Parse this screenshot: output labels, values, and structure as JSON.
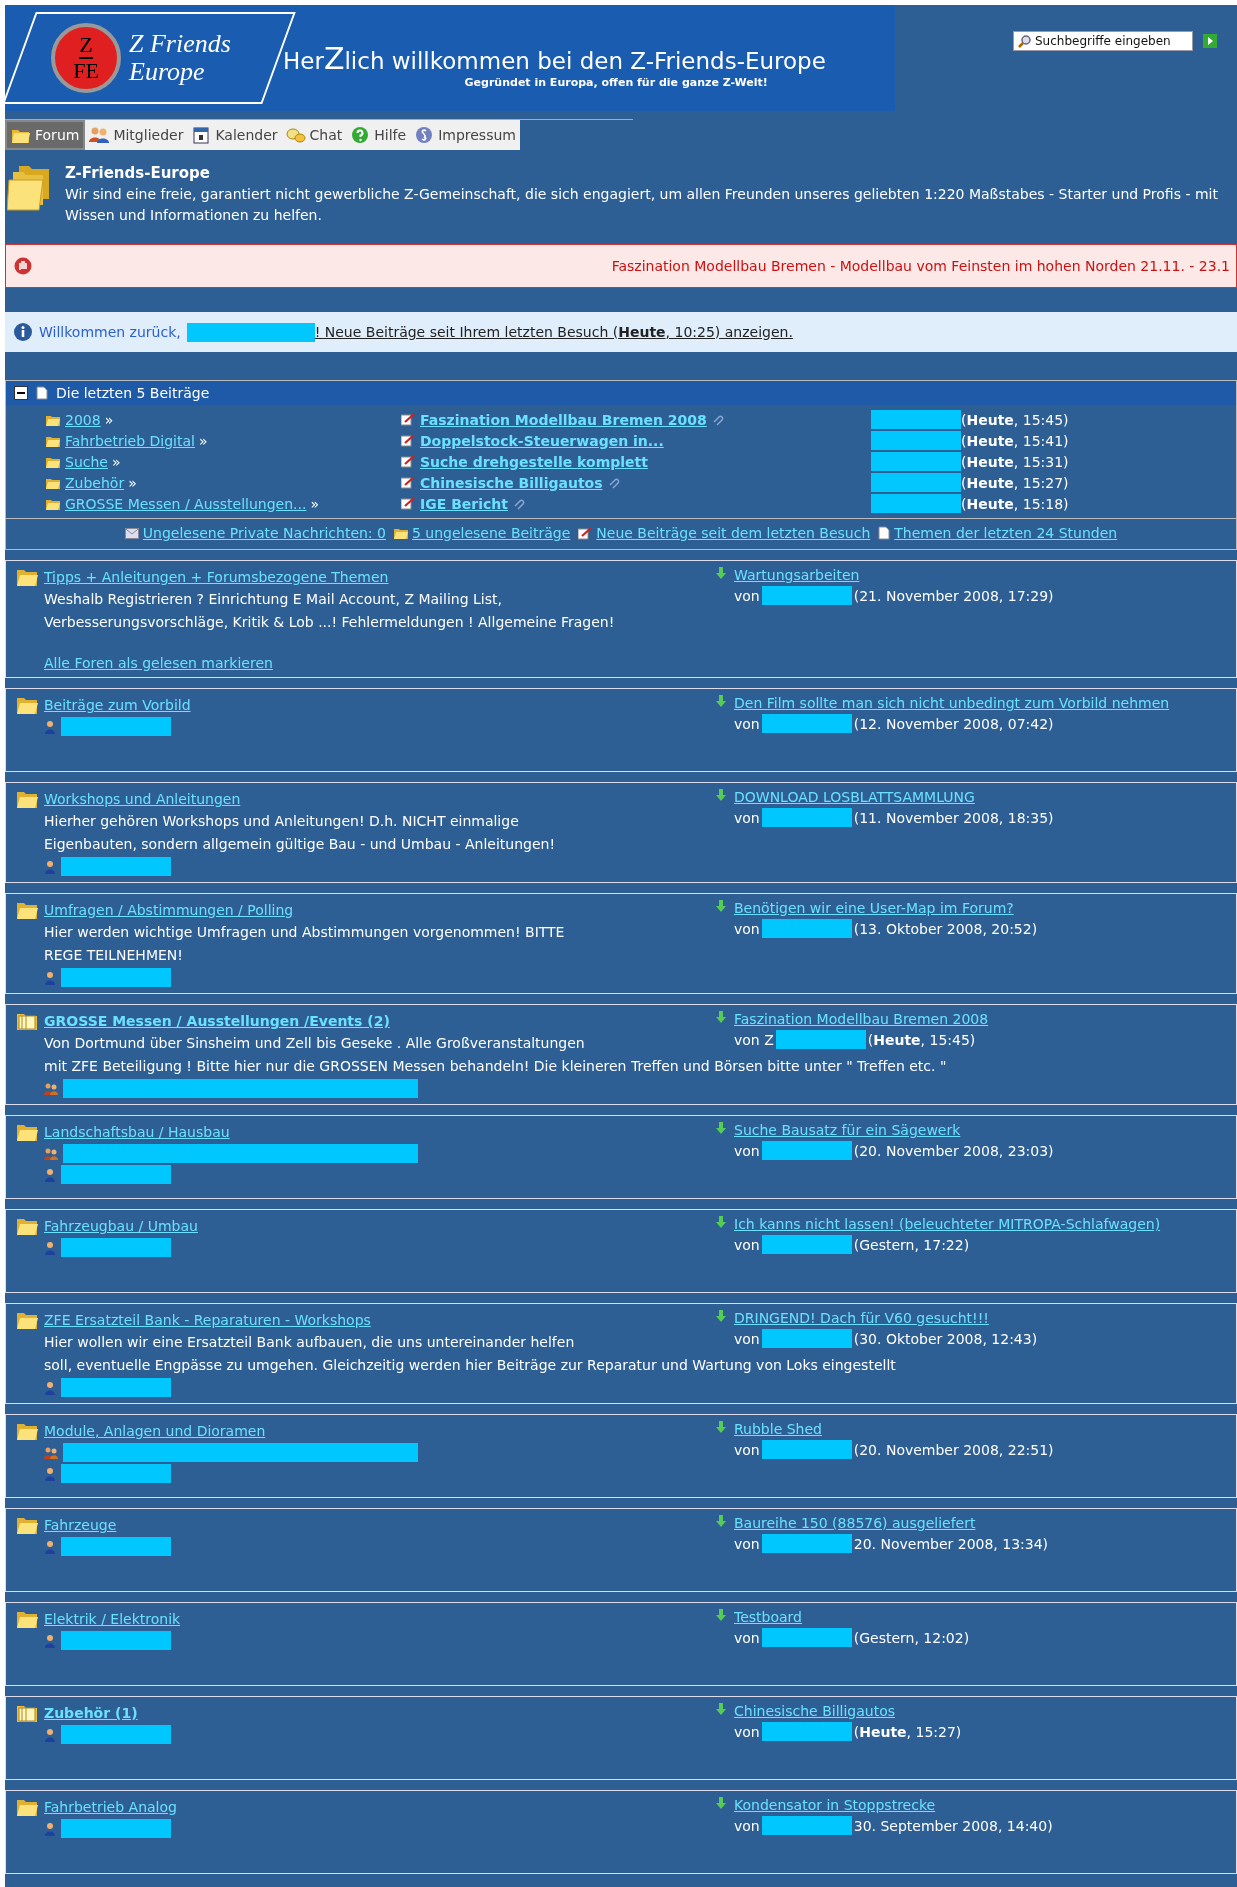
{
  "header": {
    "logo_letters": [
      "Z",
      "FE"
    ],
    "logo_name": [
      "Z Friends",
      "Europe"
    ],
    "welcome_pre": "Her",
    "welcome_big": "Z",
    "welcome_post": "lich willkommen bei den Z-Friends-Europe",
    "tagline": "Gegründet in Europa, offen für die ganze Z-Welt!",
    "search": {
      "placeholder": "Suchbegriffe eingeben"
    }
  },
  "nav": [
    {
      "label": "Forum",
      "selected": true
    },
    {
      "label": "Mitglieder",
      "selected": false
    },
    {
      "label": "Kalender",
      "selected": false
    },
    {
      "label": "Chat",
      "selected": false
    },
    {
      "label": "Hilfe",
      "selected": false
    },
    {
      "label": "Impressum",
      "selected": false
    }
  ],
  "intro": {
    "title": "Z-Friends-Europe",
    "text": "Wir sind eine freie, garantiert nicht gewerbliche Z-Gemeinschaft, die sich engagiert, um allen Freunden unseres geliebten 1:220 Maßstabes - Starter und Profis - mit Wissen und Informationen zu helfen."
  },
  "alert": "Faszination Modellbau Bremen - Modellbau vom Feinsten im hohen Norden 21.11. - 23.1",
  "welcome": {
    "greeting": "Willkommen zurück,",
    "link": "! Neue Beiträge seit Ihrem letzten Besuch (**Heute**, 10:25) anzeigen."
  },
  "recent": {
    "title": "Die letzten 5 Beiträge",
    "expanded": true,
    "rows": [
      {
        "board": "2008",
        "separator": "»",
        "topic": "Faszination Modellbau Bremen 2008",
        "attachment": true,
        "date": "(**Heute**, 15:45)"
      },
      {
        "board": "Fahrbetrieb Digital",
        "separator": "»",
        "topic": "Doppelstock-Steuerwagen in...",
        "attachment": false,
        "date": "(**Heute**, 15:41)"
      },
      {
        "board": "Suche",
        "separator": "»",
        "topic": "Suche drehgestelle komplett",
        "attachment": false,
        "date": "(**Heute**, 15:31)"
      },
      {
        "board": "Zubehör",
        "separator": "»",
        "topic": "Chinesische Billigautos",
        "attachment": true,
        "date": "(**Heute**, 15:27)"
      },
      {
        "board": "GROSSE Messen / Ausstellungen...",
        "separator": "»",
        "topic": "IGE Bericht",
        "attachment": true,
        "date": "(**Heute**, 15:18)"
      }
    ],
    "links": [
      {
        "label": "Ungelesene Private Nachrichten: 0"
      },
      {
        "label": "5 ungelesene Beiträge"
      },
      {
        "label": "Neue Beiträge seit dem letzten Besuch"
      },
      {
        "label": "Themen der letzten 24 Stunden"
      }
    ]
  },
  "boards": [
    {
      "title": "Tipps + Anleitungen + Forumsbezogene Themen",
      "new": false,
      "description": [
        "Weshalb Registrieren ? Einrichtung E Mail Account, Z Mailing List,",
        "Verbesserungsvorschläge, Kritik & Lob ...! Fehlermeldungen ! Allgemeine Fragen!"
      ],
      "mark_read": "Alle Foren als gelesen markieren",
      "last_topic": "Wartungsarbeiten",
      "last_by": "von",
      "last_date": "(21. November 2008, 17:29)"
    },
    {
      "title": "Beiträge zum Vorbild",
      "new": false,
      "moderators": [
        {
          "kind": "user"
        }
      ],
      "last_topic": "Den Film sollte man sich nicht unbedingt zum Vorbild nehmen",
      "last_by": "von",
      "last_date": "(12. November 2008, 07:42)"
    },
    {
      "title": "Workshops und Anleitungen",
      "new": false,
      "description": [
        "Hierher gehören Workshops und Anleitungen! D.h. NICHT einmalige",
        "Eigenbauten, sondern allgemein gültige Bau - und Umbau - Anleitungen!"
      ],
      "moderators": [
        {
          "kind": "user"
        }
      ],
      "last_topic": "DOWNLOAD LOSBLATTSAMMLUNG",
      "last_by": "von",
      "last_date": "(11. November 2008, 18:35)"
    },
    {
      "title": "Umfragen / Abstimmungen / Polling",
      "new": false,
      "description": [
        "Hier werden wichtige Umfragen und Abstimmungen vorgenommen! BITTE",
        "REGE TEILNEHMEN!"
      ],
      "moderators": [
        {
          "kind": "user"
        }
      ],
      "last_topic": "Benötigen wir eine User-Map im Forum?",
      "last_by": "von",
      "last_date": "(13. Oktober 2008, 20:52)"
    },
    {
      "title": "GROSSE Messen / Ausstellungen /Events (2)",
      "new": true,
      "description": [
        "Von Dortmund über Sinsheim und Zell bis Geseke . Alle Großveranstaltungen",
        "mit ZFE Beteiligung ! Bitte hier nur die GROSSEN Messen behandeln! Die kleineren Treffen und Börsen bitte unter \" Treffen etc. \""
      ],
      "moderators": [
        {
          "kind": "group"
        }
      ],
      "last_topic": "Faszination Modellbau Bremen 2008",
      "last_by": "von Z",
      "last_date": "(**Heute**, 15:45)"
    },
    {
      "title": "Landschaftsbau / Hausbau",
      "new": false,
      "moderators": [
        {
          "kind": "group"
        },
        {
          "kind": "user"
        }
      ],
      "last_topic": "Suche Bausatz für ein Sägewerk",
      "last_by": "von",
      "last_date": "(20. November 2008, 23:03)"
    },
    {
      "title": "Fahrzeugbau / Umbau",
      "new": false,
      "moderators": [
        {
          "kind": "user"
        }
      ],
      "last_topic": "Ich kanns nicht lassen! (beleuchteter MITROPA-Schlafwagen)",
      "last_by": "von",
      "last_date": "(Gestern, 17:22)"
    },
    {
      "title": "ZFE Ersatzteil Bank - Reparaturen - Workshops",
      "new": false,
      "description": [
        "Hier wollen wir eine Ersatzteil Bank aufbauen, die uns untereinander helfen",
        "soll, eventuelle Engpässe zu umgehen. Gleichzeitig werden hier Beiträge zur Reparatur und Wartung von Loks eingestellt"
      ],
      "moderators": [
        {
          "kind": "user"
        }
      ],
      "last_topic": "DRINGEND! Dach für V60 gesucht!!!",
      "last_by": "von",
      "last_date": "(30. Oktober 2008, 12:43)"
    },
    {
      "title": "Module, Anlagen und Dioramen",
      "new": false,
      "moderators": [
        {
          "kind": "group"
        },
        {
          "kind": "user"
        }
      ],
      "last_topic": "Rubble Shed",
      "last_by": "von",
      "last_date": "(20. November 2008, 22:51)"
    },
    {
      "title": "Fahrzeuge",
      "new": false,
      "moderators": [
        {
          "kind": "user"
        }
      ],
      "last_topic": "Baureihe 150 (88576) ausgeliefert",
      "last_by": "von",
      "last_date": "20. November 2008, 13:34)"
    },
    {
      "title": "Elektrik / Elektronik",
      "new": false,
      "moderators": [
        {
          "kind": "user"
        }
      ],
      "last_topic": "Testboard",
      "last_by": "von",
      "last_date": "(Gestern, 12:02)"
    },
    {
      "title": "Zubehör (1)",
      "new": true,
      "moderators": [
        {
          "kind": "user"
        }
      ],
      "last_topic": "Chinesische Billigautos",
      "last_by": "von",
      "last_date": "(**Heute**, 15:27)"
    },
    {
      "title": "Fahrbetrieb Analog",
      "new": false,
      "moderators": [
        {
          "kind": "user"
        }
      ],
      "last_topic": "Kondensator in Stoppstrecke",
      "last_by": "von",
      "last_date": "30. September 2008, 14:40)"
    }
  ]
}
